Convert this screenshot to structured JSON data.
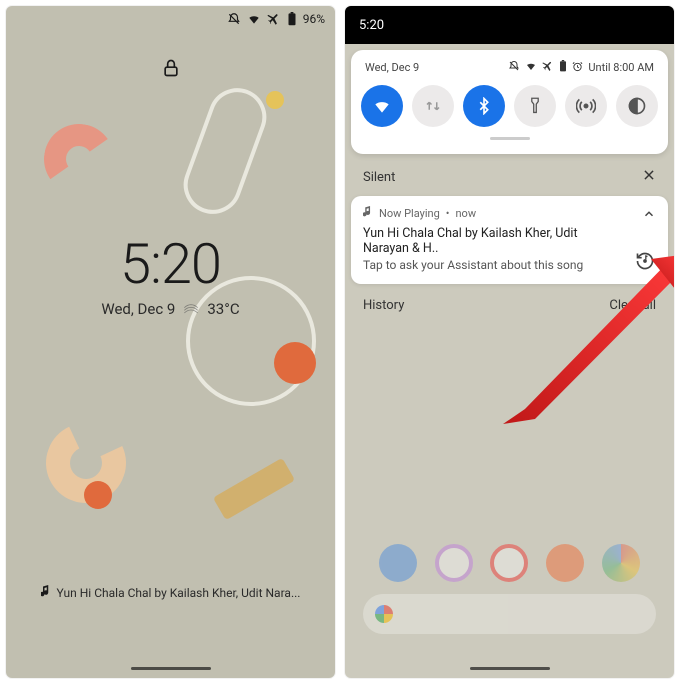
{
  "left": {
    "status": {
      "battery": "96%"
    },
    "time": "5:20",
    "date": "Wed, Dec 9",
    "temp": "33°C",
    "now_playing": "Yun Hi Chala Chal by Kailash Kher, Udit Nara..."
  },
  "right": {
    "time": "5:20",
    "qs_date": "Wed, Dec 9",
    "alarm": "Until 8:00 AM",
    "tiles": [
      "wifi",
      "swap",
      "bluetooth",
      "flashlight",
      "hotspot",
      "darkmode"
    ],
    "silent_label": "Silent",
    "notif": {
      "app": "Now Playing",
      "when": "now",
      "title": "Yun Hi Chala Chal by Kailash Kher, Udit Narayan & H..",
      "subtitle": "Tap to ask your Assistant about this song"
    },
    "history": "History",
    "clear": "Clear all"
  }
}
